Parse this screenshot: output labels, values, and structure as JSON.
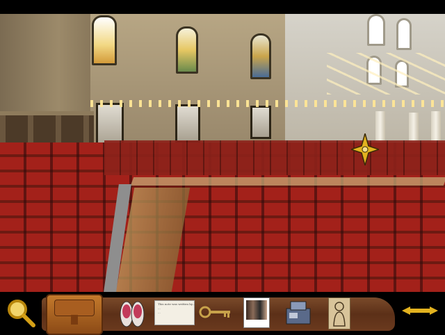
{
  "scene": {
    "location_name": "",
    "cursor": "navigation-compass-cursor"
  },
  "inventory": {
    "note_text": "This note was written by... \n...\n...",
    "items": [
      {
        "name": "magnifying-glass-icon"
      },
      {
        "name": "satchel-icon"
      },
      {
        "name": "sneakers-icon"
      },
      {
        "name": "handwritten-note-icon"
      },
      {
        "name": "key-icon"
      },
      {
        "name": "photograph-icon"
      },
      {
        "name": "machine-icon"
      },
      {
        "name": "figurine-sketch-icon"
      }
    ],
    "scroll_left": "arrow-left-icon",
    "scroll_right": "arrow-right-icon"
  },
  "colors": {
    "carpet_red": "#a3211a",
    "inventory_brown": "#5c3018",
    "arrow_gold": "#e2b21f"
  }
}
